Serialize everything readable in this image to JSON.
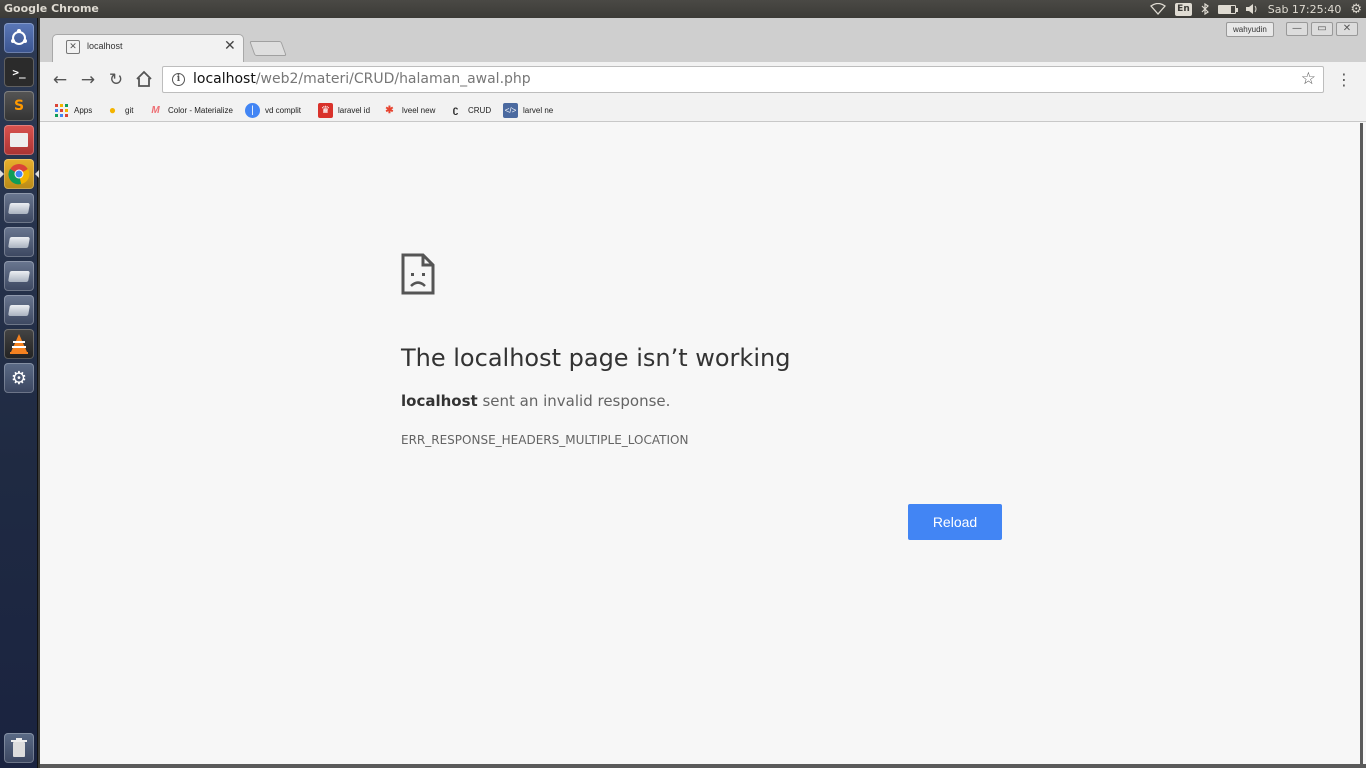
{
  "top_panel": {
    "app_name": "Google Chrome",
    "keyboard": "En",
    "clock": "Sab 17:25:40"
  },
  "browser": {
    "tab": {
      "title": "localhost"
    },
    "profile": "wahyudin",
    "url_host": "localhost",
    "url_path": "/web2/materi/CRUD/halaman_awal.php",
    "bookmarks": [
      {
        "label": "Apps",
        "icon": "apps-grid-icon"
      },
      {
        "label": "git",
        "icon": "lightbulb-icon"
      },
      {
        "label": "Color - Materialize",
        "icon": "materialize-icon"
      },
      {
        "label": "vd complit",
        "icon": "vd-icon"
      },
      {
        "label": "laravel id",
        "icon": "laravel-icon"
      },
      {
        "label": "lveel new",
        "icon": "laravel-icon"
      },
      {
        "label": "CRUD",
        "icon": "crud-icon"
      },
      {
        "label": "larvel ne",
        "icon": "code-icon"
      }
    ]
  },
  "error_page": {
    "title": "The localhost page isn’t working",
    "desc_host": "localhost",
    "desc_rest": " sent an invalid response.",
    "code": "ERR_RESPONSE_HEADERS_MULTIPLE_LOCATION",
    "reload_label": "Reload"
  },
  "colors": {
    "reload_button": "#4285f4",
    "page_bg": "#f7f7f7",
    "launcher_bg": "#2d3a54"
  }
}
